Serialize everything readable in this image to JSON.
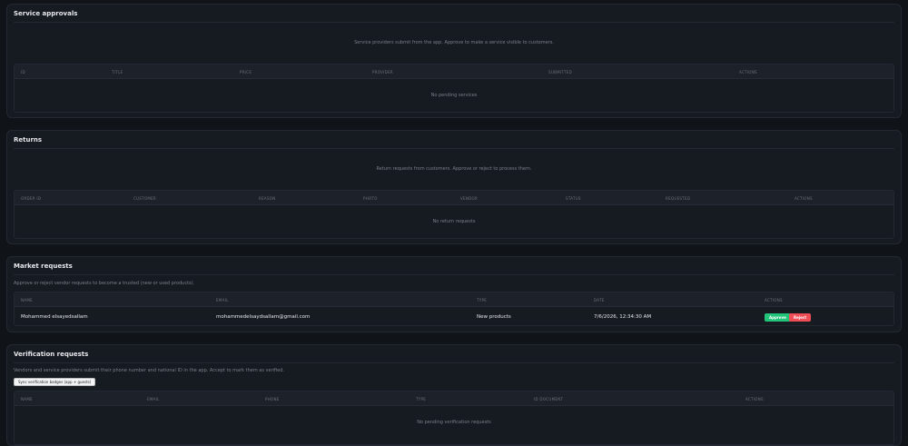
{
  "service_approvals": {
    "title": "Service approvals",
    "description": "Service providers submit from the app. Approve to make a service visible to customers.",
    "columns": [
      "ID",
      "TITLE",
      "PRICE",
      "PROVIDER",
      "SUBMITTED",
      "ACTIONS"
    ],
    "empty_text": "No pending services"
  },
  "returns": {
    "title": "Returns",
    "description": "Return requests from customers. Approve or reject to process them.",
    "columns": [
      "ORDER ID",
      "CUSTOMER",
      "REASON",
      "PHOTO",
      "VENDOR",
      "STATUS",
      "REQUESTED",
      "ACTIONS"
    ],
    "empty_text": "No return requests"
  },
  "market_requests": {
    "title": "Market requests",
    "description": "Approve or reject vendor requests to become a trusted (new or used products).",
    "columns": [
      "NAME",
      "EMAIL",
      "TYPE",
      "DATE",
      "ACTIONS"
    ],
    "rows": [
      {
        "name": "Mohammed elsayedsallam",
        "email": "mohammedelsaydsallam@gmail.com",
        "type": "New products",
        "date": "7/6/2026, 12:34:30 AM",
        "approve_label": "Approve",
        "reject_label": "Reject"
      }
    ]
  },
  "verification_requests": {
    "title": "Verification requests",
    "description": "Vendors and service providers submit their phone number and national ID in the app. Accept to mark them as verified.",
    "sync_button": "Sync verification badges (app + guests)",
    "columns": [
      "NAME",
      "EMAIL",
      "PHONE",
      "TYPE",
      "ID DOCUMENT",
      "ACTIONS"
    ],
    "empty_text": "No pending verification requests"
  },
  "colors": {
    "background": "#101318",
    "card": "#161a21",
    "approve": "#22c47a",
    "reject": "#ef4d55"
  }
}
